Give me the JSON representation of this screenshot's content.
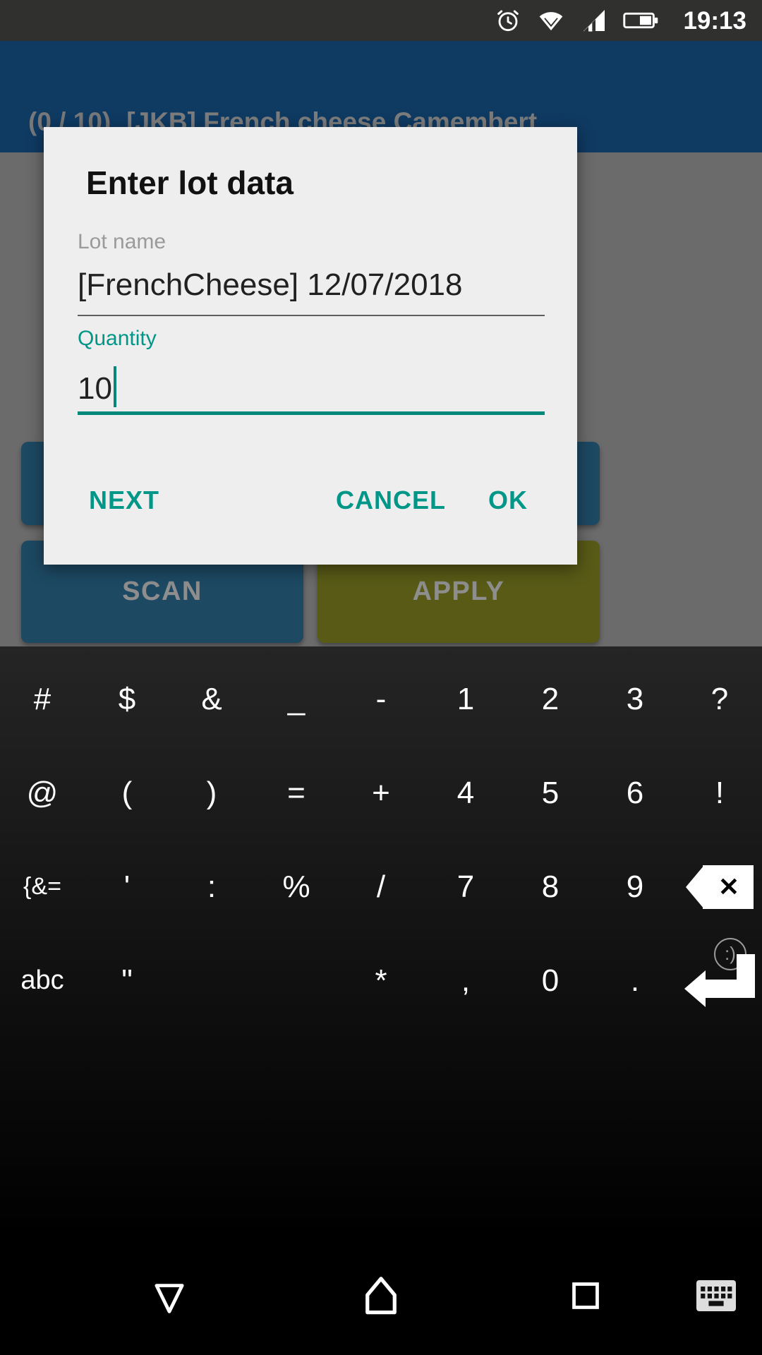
{
  "status_bar": {
    "time": "19:13",
    "icons": [
      "alarm-icon",
      "wifi-icon",
      "signal-icon",
      "battery-icon"
    ],
    "background": "#30302f"
  },
  "app_bar": {
    "count": "(0 / 10)",
    "title": "[JKB] French cheese Camembert",
    "background": "#0f3a62",
    "text_color": "#7c7c7c"
  },
  "background_screen": {
    "scrim_color": "#6b6b6b",
    "buttons": [
      {
        "label": "",
        "name": "hidden-action-button",
        "color": "#1d4963"
      },
      {
        "label": "SCAN",
        "name": "scan-button",
        "color": "#1d4963"
      },
      {
        "label": "APPLY",
        "name": "apply-button",
        "color": "#585a16"
      }
    ]
  },
  "dialog": {
    "title": "Enter lot data",
    "background": "#eeeeee",
    "accent": "#009688",
    "fields": [
      {
        "label": "Lot name",
        "value": "[FrenchCheese] 12/07/2018",
        "focused": false
      },
      {
        "label": "Quantity",
        "value": "10",
        "focused": true
      }
    ],
    "actions": {
      "next": "NEXT",
      "cancel": "CANCEL",
      "ok": "OK"
    }
  },
  "keyboard": {
    "mode": "symbols",
    "rows": [
      [
        {
          "label": "#",
          "name": "key-hash"
        },
        {
          "label": "$",
          "name": "key-dollar"
        },
        {
          "label": "&",
          "name": "key-ampersand"
        },
        {
          "label": "_",
          "name": "key-underscore"
        },
        {
          "label": "-",
          "name": "key-hyphen"
        },
        {
          "label": "1",
          "name": "key-1"
        },
        {
          "label": "2",
          "name": "key-2"
        },
        {
          "label": "3",
          "name": "key-3"
        },
        {
          "label": "?",
          "name": "key-question"
        }
      ],
      [
        {
          "label": "@",
          "name": "key-at"
        },
        {
          "label": "(",
          "name": "key-paren-open"
        },
        {
          "label": ")",
          "name": "key-paren-close"
        },
        {
          "label": "=",
          "name": "key-equals"
        },
        {
          "label": "+",
          "name": "key-plus"
        },
        {
          "label": "4",
          "name": "key-4"
        },
        {
          "label": "5",
          "name": "key-5"
        },
        {
          "label": "6",
          "name": "key-6"
        },
        {
          "label": "!",
          "name": "key-exclamation"
        }
      ],
      [
        {
          "label": "{&=",
          "name": "key-symbols-shift"
        },
        {
          "label": "'",
          "name": "key-apostrophe"
        },
        {
          "label": ":",
          "name": "key-colon"
        },
        {
          "label": "%",
          "name": "key-percent"
        },
        {
          "label": "/",
          "name": "key-slash"
        },
        {
          "label": "7",
          "name": "key-7"
        },
        {
          "label": "8",
          "name": "key-8"
        },
        {
          "label": "9",
          "name": "key-9"
        },
        {
          "label": "",
          "name": "key-backspace"
        }
      ],
      [
        {
          "label": "abc",
          "name": "key-abc"
        },
        {
          "label": "\"",
          "name": "key-quote"
        },
        {
          "label": "",
          "name": "key-space"
        },
        {
          "label": "*",
          "name": "key-asterisk"
        },
        {
          "label": ",",
          "name": "key-comma"
        },
        {
          "label": "0",
          "name": "key-0"
        },
        {
          "label": ".",
          "name": "key-period"
        },
        {
          "label": "",
          "name": "key-enter"
        }
      ]
    ],
    "emoji_badge": ":)"
  },
  "nav_bar": {
    "back": "back-icon",
    "home": "home-icon",
    "recents": "recents-icon",
    "keyboard_switcher": "keyboard-switch-icon"
  }
}
